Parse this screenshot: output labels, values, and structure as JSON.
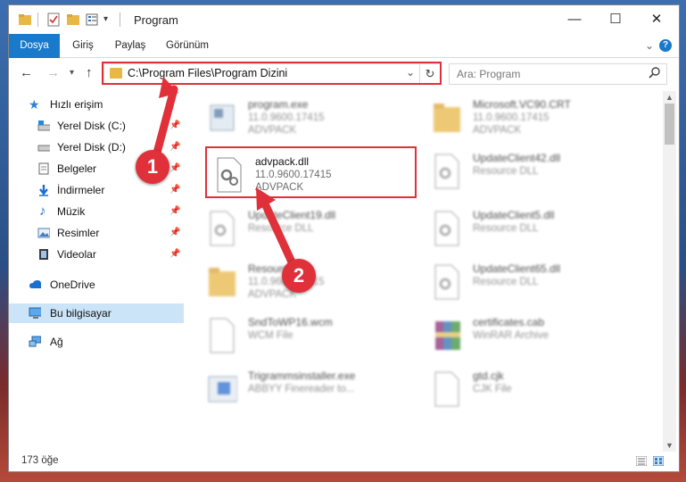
{
  "window": {
    "title": "Program",
    "controls": {
      "minimize": "—",
      "maximize": "☐",
      "close": "✕"
    }
  },
  "ribbon": {
    "tabs": [
      "Dosya",
      "Giriş",
      "Paylaş",
      "Görünüm"
    ],
    "help": "?"
  },
  "address": {
    "path": "C:\\Program Files\\Program Dizini",
    "refresh": "↻",
    "dropdown": "⌄"
  },
  "search": {
    "placeholder": "Ara: Program",
    "icon": "search-icon"
  },
  "sidebar": {
    "quick_access": "Hızlı erişim",
    "items": [
      {
        "label": "Yerel Disk (C:)",
        "icon": "drive-icon"
      },
      {
        "label": "Yerel Disk (D:)",
        "icon": "drive-icon"
      },
      {
        "label": "Belgeler",
        "icon": "documents-icon"
      },
      {
        "label": "İndirmeler",
        "icon": "download-icon"
      },
      {
        "label": "Müzik",
        "icon": "music-icon"
      },
      {
        "label": "Resimler",
        "icon": "pictures-icon"
      },
      {
        "label": "Videolar",
        "icon": "videos-icon"
      }
    ],
    "onedrive": "OneDrive",
    "this_pc": "Bu bilgisayar",
    "network": "Ağ"
  },
  "files": {
    "left": [
      {
        "name": "program.exe",
        "line2": "11.0.9600.17415",
        "line3": "ADVPACK",
        "icon": "exe-icon"
      },
      {
        "name": "advpack.dll",
        "line2": "11.0.9600.17415",
        "line3": "ADVPACK",
        "icon": "dll-gear-icon"
      },
      {
        "name": "UpdateClient19.dll",
        "line2": "Resource DLL",
        "line3": "",
        "icon": "dll-icon"
      },
      {
        "name": "Resources",
        "line2": "11.0.9600.17415",
        "line3": "ADVPACK",
        "icon": "folder-icon"
      },
      {
        "name": "SndToWP16.wcm",
        "line2": "WCM File",
        "line3": "",
        "icon": "file-icon"
      },
      {
        "name": "Trigrammsinstaller.exe",
        "line2": "ABBYY Finereader to...",
        "line3": "",
        "icon": "installer-icon"
      }
    ],
    "right": [
      {
        "name": "Microsoft.VC90.CRT",
        "line2": "11.0.9600.17415",
        "line3": "ADVPACK",
        "icon": "folder-icon"
      },
      {
        "name": "UpdateClient42.dll",
        "line2": "Resource DLL",
        "line3": "",
        "icon": "dll-icon"
      },
      {
        "name": "UpdateClient5.dll",
        "line2": "Resource DLL",
        "line3": "",
        "icon": "dll-icon"
      },
      {
        "name": "UpdateClient65.dll",
        "line2": "Resource DLL",
        "line3": "",
        "icon": "dll-icon"
      },
      {
        "name": "certificates.cab",
        "line2": "WinRAR Archive",
        "line3": "",
        "icon": "winrar-icon"
      },
      {
        "name": "gtd.cjk",
        "line2": "CJK File",
        "line3": "",
        "icon": "file-icon"
      }
    ]
  },
  "status": {
    "count": "173 öğe"
  },
  "markers": {
    "one": "1",
    "two": "2"
  },
  "colors": {
    "accent": "#1979ca",
    "highlight": "#e0303a",
    "selected": "#cce4f7"
  }
}
